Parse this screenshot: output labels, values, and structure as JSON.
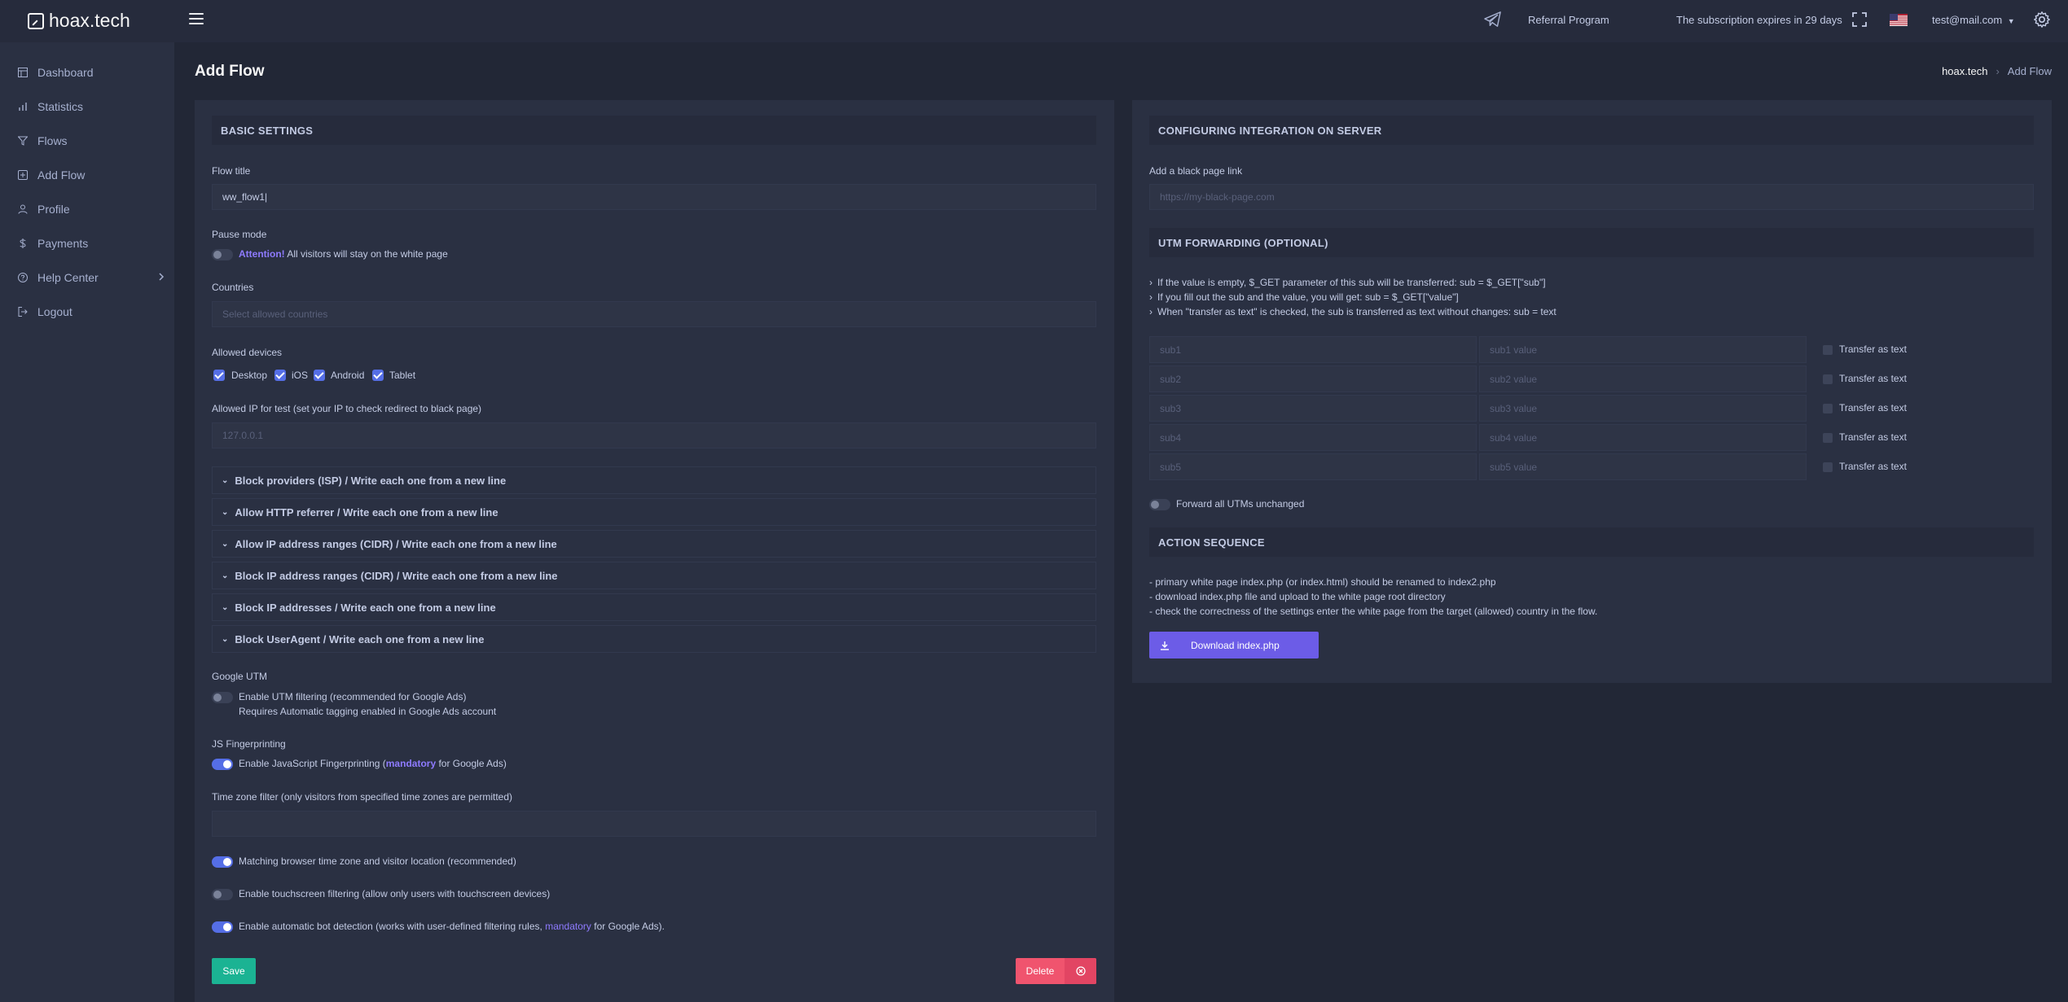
{
  "header": {
    "logo_text": "hoax.tech",
    "referral": "Referral Program",
    "expires": "The subscription expires in 29 days",
    "user": "test@mail.com"
  },
  "sidebar": {
    "items": [
      {
        "label": "Dashboard",
        "icon": "dashboard-icon"
      },
      {
        "label": "Statistics",
        "icon": "bar-chart-icon"
      },
      {
        "label": "Flows",
        "icon": "filter-icon"
      },
      {
        "label": "Add Flow",
        "icon": "plus-square-icon"
      },
      {
        "label": "Profile",
        "icon": "user-icon"
      },
      {
        "label": "Payments",
        "icon": "dollar-icon"
      },
      {
        "label": "Help Center",
        "icon": "help-circle-icon"
      },
      {
        "label": "Logout",
        "icon": "logout-icon"
      }
    ]
  },
  "page": {
    "title": "Add Flow",
    "breadcrumb_root": "hoax.tech",
    "breadcrumb_current": "Add Flow"
  },
  "basic": {
    "section_title": "BASIC SETTINGS",
    "flow_title_label": "Flow title",
    "flow_title_value": "ww_flow1|",
    "pause_label": "Pause mode",
    "pause_attention": "Attention!",
    "pause_text": " All visitors will stay on the white page",
    "countries_label": "Countries",
    "countries_placeholder": "Select allowed countries",
    "devices_label": "Allowed devices",
    "devices": [
      "Desktop",
      "iOS",
      "Android",
      "Tablet"
    ],
    "ip_label": "Allowed IP for test (set your IP to check redirect to black page)",
    "ip_placeholder": "127.0.0.1",
    "accordions": [
      "Block providers (ISP) / Write each one from a new line",
      "Allow HTTP referrer / Write each one from a new line",
      "Allow IP address ranges (CIDR) / Write each one from a new line",
      "Block IP address ranges (CIDR) / Write each one from a new line",
      "Block IP addresses / Write each one from a new line",
      "Block UserAgent / Write each one from a new line"
    ],
    "google_utm_label": "Google UTM",
    "google_utm_text": "Enable UTM filtering (recommended for Google Ads)",
    "google_utm_sub": "Requires Automatic tagging enabled in Google Ads account",
    "js_label": "JS Fingerprinting",
    "js_text_a": "Enable JavaScript Fingerprinting (",
    "js_mandatory": "mandatory",
    "js_text_b": " for Google Ads)",
    "tz_label": "Time zone filter (only visitors from specified time zones are permitted)",
    "tz_match_text": "Matching browser time zone and visitor location (recommended)",
    "touch_text": "Enable touchscreen filtering (allow only users with touchscreen devices)",
    "bot_text_a": "Enable automatic bot detection (works with user-defined filtering rules, ",
    "bot_mandatory": "mandatory",
    "bot_text_b": " for Google Ads).",
    "save": "Save",
    "delete": "Delete"
  },
  "integration": {
    "section_title": "CONFIGURING INTEGRATION ON SERVER",
    "black_label": "Add a black page link",
    "black_placeholder": "https://my-black-page.com",
    "utm_title": "UTM FORWARDING (OPTIONAL)",
    "notes": [
      "If the value is empty, $_GET parameter of this sub will be transferred: sub = $_GET[\"sub\"]",
      "If you fill out the sub and the value, you will get: sub = $_GET[\"value\"]",
      "When \"transfer as text\" is checked, the sub is transferred as text without changes: sub = text"
    ],
    "subs": [
      {
        "sub": "sub1",
        "value": "sub1 value"
      },
      {
        "sub": "sub2",
        "value": "sub2 value"
      },
      {
        "sub": "sub3",
        "value": "sub3 value"
      },
      {
        "sub": "sub4",
        "value": "sub4 value"
      },
      {
        "sub": "sub5",
        "value": "sub5 value"
      }
    ],
    "transfer_label": "Transfer as text",
    "forward_all": "Forward all UTMs unchanged",
    "action_title": "ACTION SEQUENCE",
    "actions": [
      "- primary white page index.php (or index.html) should be renamed to index2.php",
      "- download index.php file and upload to the white page root directory",
      "- check the correctness of the settings enter the white page from the target (allowed) country in the flow."
    ],
    "download": "Download index.php"
  }
}
